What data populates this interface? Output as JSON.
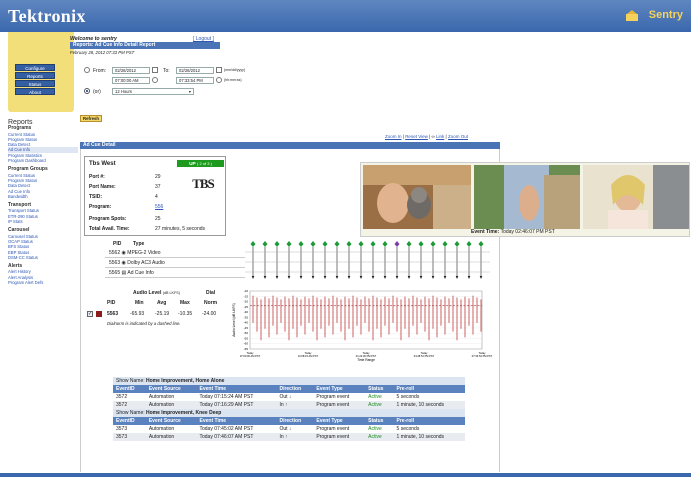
{
  "header": {
    "brand": "Tektronix",
    "product": "Sentry"
  },
  "nav": {
    "buttons": [
      "Configure",
      "Reports",
      "Status",
      "About"
    ]
  },
  "sidebar": {
    "title": "Reports",
    "groups": [
      {
        "heading": "Programs",
        "items": [
          "Current Status",
          "Program Status",
          "Data Detect",
          "Ad Cue Info",
          "Program Statistics",
          "Program Dashboard"
        ]
      },
      {
        "heading": "Program Groups",
        "items": [
          "Current Status",
          "Program Status",
          "Data Detect",
          "Ad Cue Info",
          "Bandwidth"
        ]
      },
      {
        "heading": "Transport",
        "items": [
          "Transport Status",
          "ETR-290 Status",
          "IP Stats"
        ]
      },
      {
        "heading": "Carousel",
        "items": [
          "Carousel Status",
          "OCAP Status",
          "BFS Status",
          "EBP Status",
          "DSM-CC Status"
        ]
      },
      {
        "heading": "Alerts",
        "items": [
          "Alert History",
          "Alert Analysis",
          "Program Alert Defs"
        ]
      }
    ]
  },
  "welcome": {
    "text": "Welcome to sentry",
    "logout": "[ Logout ]",
    "report_title": "Reports: Ad Cue Info Detail Report",
    "date": "February 28, 2012 07:33 PM PST"
  },
  "timerange": {
    "from_label": "From:",
    "from_date": "02/28/2012",
    "from_time": "07:00:00 AM",
    "to_label": "To:",
    "to_date": "02/28/2012",
    "to_time": "07:33:54 PM",
    "date_fmt": "(mm/dd/yyyy)",
    "time_fmt": "(hh:mm:ss)",
    "or_label": "(or)",
    "hours_select": "12 Hours"
  },
  "refresh": "Refresh",
  "zoom": {
    "zoom_in": "Zoom In",
    "reset": "Reset View",
    "link": "Link",
    "zoom_out": "Zoom Out"
  },
  "section_title": "Ad Cue Detail",
  "program": {
    "name": "Tbs West",
    "status": "UP",
    "status_detail": "( 2 of 3 )",
    "logo_text": "TBS",
    "port_num_label": "Port #:",
    "port_num": "29",
    "port_name_label": "Port Name:",
    "port_name": "37",
    "tsid_label": "TSID:",
    "tsid": "4",
    "program_label": "Program:",
    "program": "556",
    "spots_label": "Program Spots:",
    "spots": "25",
    "avail_label": "Total Avail. Time:",
    "avail": "27 minutes, 5 seconds"
  },
  "event_time": {
    "label": "Event Time:",
    "value": "Today 02:46:07 PM PST"
  },
  "pids": {
    "header_pid": "PID",
    "header_type": "Type",
    "rows": [
      {
        "pid": "5562",
        "type": "MPEG-2 Video"
      },
      {
        "pid": "5563",
        "type": "Dolby AC3 Audio"
      },
      {
        "pid": "5565",
        "type": "Ad Cue Info"
      }
    ]
  },
  "audio": {
    "title": "Audio Level",
    "unit": "(dB LKFS)",
    "dial": "Dial",
    "cols": [
      "PID",
      "Min",
      "Avg",
      "Max",
      "Norm"
    ],
    "row": {
      "pid": "5563",
      "min": "-65.93",
      "avg": "-25.19",
      "max": "-10.35",
      "norm": "-24.00"
    },
    "note": "Dialnorm is indicated by a dashed line."
  },
  "graph": {
    "ylabel": "Audio Level (dB LKFS)",
    "xlabel": "Time Range",
    "xticks": [
      "Today\n07:00:00 AM PST",
      "Today\n10:08:15 AM PST",
      "Today\n01:22:30 PM PST",
      "Today\n04:28:51 PM PST",
      "Today\n07:33:54 PM PST"
    ],
    "yticks": [
      "-10",
      "-15",
      "-20",
      "-25",
      "-30",
      "-35",
      "-40",
      "-45",
      "-50",
      "-55",
      "-60",
      "-65"
    ]
  },
  "events": [
    {
      "show_label": "Show Name:",
      "show": "Home Improvement, Home Alone",
      "rows": [
        {
          "id": "3572",
          "source": "Automation",
          "time": "Today 07:15:24 AM PST",
          "dir": "Out",
          "type": "Program event",
          "status": "Active",
          "preroll": "5 seconds"
        },
        {
          "id": "3572",
          "source": "Automation",
          "time": "Today 07:16:29 AM PST",
          "dir": "In",
          "type": "Program event",
          "status": "Active",
          "preroll": "1 minute, 10 seconds"
        }
      ]
    },
    {
      "show_label": "Show Name:",
      "show": "Home Improvement, Knee Deep",
      "rows": [
        {
          "id": "3573",
          "source": "Automation",
          "time": "Today 07:45:02 AM PST",
          "dir": "Out",
          "type": "Program event",
          "status": "Active",
          "preroll": "5 seconds"
        },
        {
          "id": "3573",
          "source": "Automation",
          "time": "Today 07:46:07 AM PST",
          "dir": "In",
          "type": "Program event",
          "status": "Active",
          "preroll": "1 minute, 10 seconds"
        }
      ]
    }
  ],
  "event_cols": [
    "EventID",
    "Event Source",
    "Event Time",
    "Direction",
    "Event Type",
    "Status",
    "Pre-roll"
  ]
}
